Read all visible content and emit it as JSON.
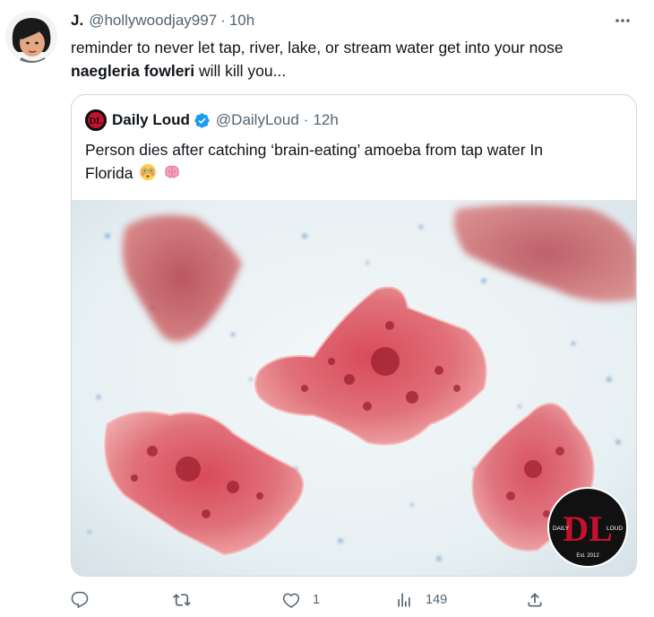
{
  "tweet": {
    "author_name": "J.",
    "author_handle": "@hollywoodjay997",
    "separator": "·",
    "time": "10h",
    "text_line1": "reminder to never let tap, river, lake, or stream water get into your nose",
    "text_bold": "naegleria fowleri",
    "text_rest": " will kill you..."
  },
  "quote": {
    "author_name": "Daily Loud",
    "author_handle": "@DailyLoud",
    "separator": "·",
    "time": "12h",
    "text_line1": "Person dies after catching ‘brain-eating’ amoeba from tap water In",
    "text_line2": "Florida",
    "logo_text": "DL",
    "badge_left": "DAILY",
    "badge_right": "LOUD",
    "badge_bottom": "Est. 2012"
  },
  "actions": {
    "reply_count": "",
    "retweet_count": "",
    "like_count": "1",
    "views_count": "149"
  },
  "icons": [
    "more-icon",
    "verified-icon",
    "flushed-face-emoji",
    "brain-emoji",
    "reply-icon",
    "retweet-icon",
    "like-icon",
    "views-icon",
    "share-icon"
  ],
  "colors": {
    "text": "#0f1419",
    "secondary": "#536471",
    "border": "#cfd9de",
    "verified": "#1d9bf0",
    "brand_red": "#c8102e"
  }
}
